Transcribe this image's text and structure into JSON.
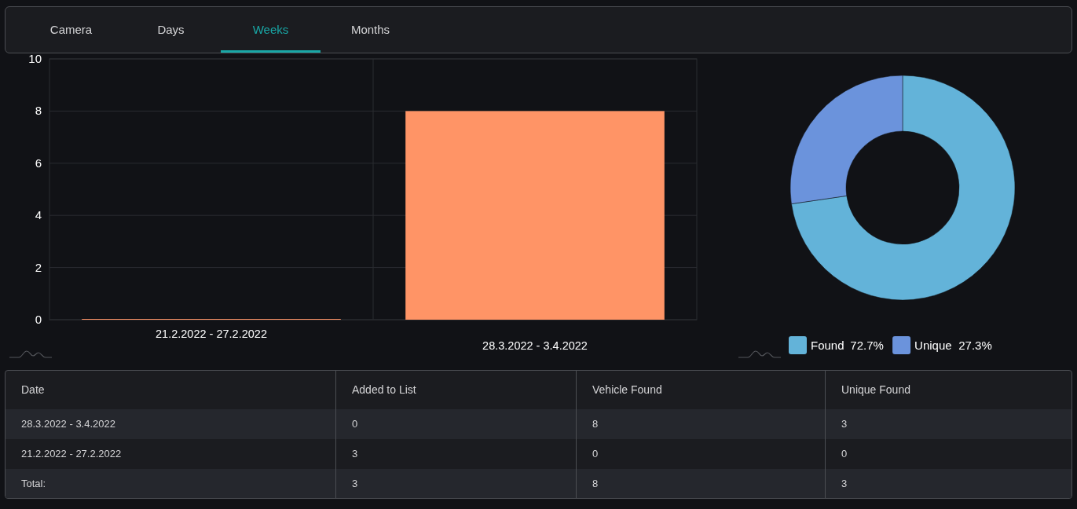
{
  "tabs": [
    {
      "label": "Camera",
      "selected": false
    },
    {
      "label": "Days",
      "selected": false
    },
    {
      "label": "Weeks",
      "selected": true
    },
    {
      "label": "Months",
      "selected": false
    }
  ],
  "bar_chart": {
    "chart_data": {
      "type": "bar",
      "categories": [
        "21.2.2022 - 27.2.2022",
        "28.3.2022 - 3.4.2022"
      ],
      "series": [
        {
          "color": "#ff9466",
          "values": [
            0,
            8
          ]
        }
      ],
      "ylim": [
        0,
        10
      ],
      "yticks": [
        0,
        2,
        4,
        6,
        8,
        10
      ],
      "grid": true
    }
  },
  "donut_chart": {
    "chart_data": {
      "type": "donut",
      "categories": [
        "Found",
        "Unique"
      ],
      "values": [
        72.7,
        27.3
      ],
      "colors": [
        "#63b3d9",
        "#6b93dc"
      ],
      "value_labels": [
        "72.7%",
        "27.3%"
      ],
      "legend": true
    }
  },
  "table": {
    "columns": [
      "Date",
      "Added to List",
      "Vehicle Found",
      "Unique Found"
    ],
    "rows": [
      [
        "28.3.2022 - 3.4.2022",
        "0",
        "8",
        "3"
      ],
      [
        "21.2.2022 - 27.2.2022",
        "3",
        "0",
        "0"
      ],
      [
        "Total:",
        "3",
        "8",
        "3"
      ]
    ]
  }
}
